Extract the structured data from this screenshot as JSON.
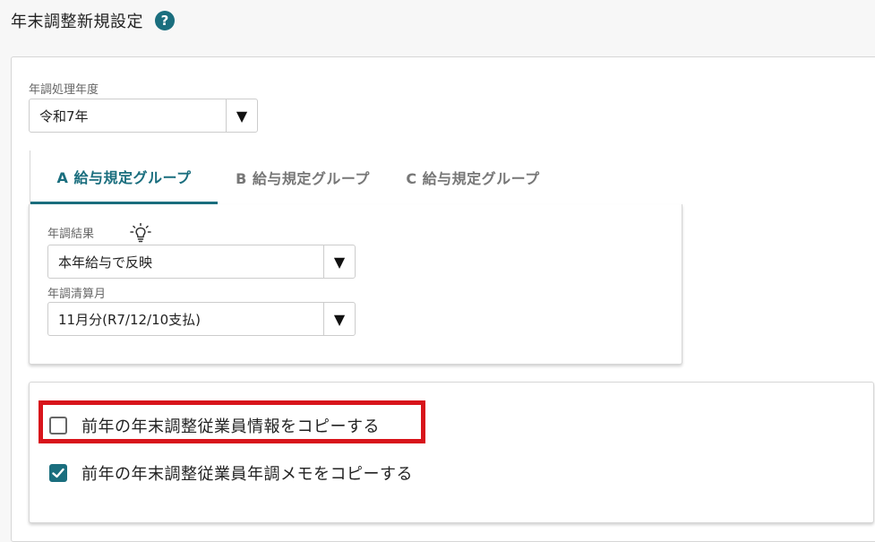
{
  "header": {
    "title": "年末調整新規設定",
    "help_icon": "?"
  },
  "fiscal_year": {
    "label": "年調処理年度",
    "value": "令和7年",
    "arrow": "▼"
  },
  "tabs": [
    {
      "label": "A 給与規定グループ",
      "active": true
    },
    {
      "label": "B 給与規定グループ",
      "active": false
    },
    {
      "label": "C 給与規定グループ",
      "active": false
    }
  ],
  "group_settings": {
    "result_label": "年調結果",
    "result_icon": "lightbulb-icon",
    "result_value": "本年給与で反映",
    "settlement_label": "年調清算月",
    "settlement_value": "11月分(R7/12/10支払)",
    "arrow": "▼"
  },
  "copy_options": [
    {
      "label": "前年の年末調整従業員情報をコピーする",
      "checked": false,
      "highlighted": true
    },
    {
      "label": "前年の年末調整従業員年調メモをコピーする",
      "checked": true,
      "highlighted": false
    }
  ],
  "colors": {
    "accent": "#1a6e7e",
    "highlight": "#d8141b"
  }
}
